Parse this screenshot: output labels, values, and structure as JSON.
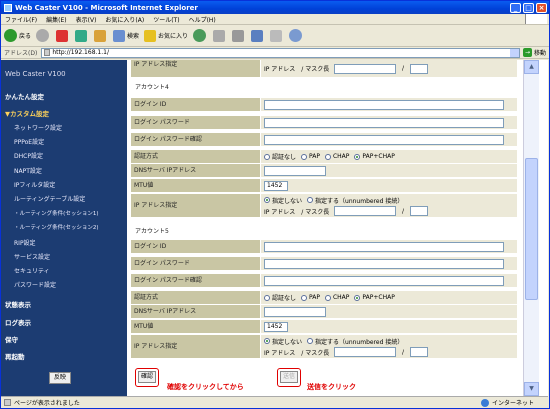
{
  "window": {
    "title": "Web Caster V100 - Microsoft Internet Explorer"
  },
  "menu": [
    "ファイル(F)",
    "編集(E)",
    "表示(V)",
    "お気に入り(A)",
    "ツール(T)",
    "ヘルプ(H)"
  ],
  "toolbar": {
    "back": "戻る",
    "search": "検索",
    "favorites": "お気に入り"
  },
  "address": {
    "label": "アドレス(D)",
    "url": "http://192.168.1.1/",
    "go": "移動"
  },
  "sidebar": {
    "brand": "Web Caster V100",
    "easy": "かんたん設定",
    "custom": "▼カスタム設定",
    "items": [
      "ネットワーク設定",
      "PPPoE設定",
      "DHCP設定",
      "NAPT設定",
      "IPフィルタ設定",
      "ルーティングテーブル設定",
      "・ルーティング条件(セッション1)",
      "・ルーティング条件(セッション2)",
      "RIP設定",
      "サービス設定",
      "セキュリティ",
      "パスワード設定"
    ],
    "status": "状態表示",
    "log": "ログ表示",
    "save": "保守",
    "reboot": "再起動",
    "reflect": "反映"
  },
  "form": {
    "top_ip_label": "IP アドレス指定",
    "ip_mask": "IP アドレス　/ マスク長",
    "slash": "/",
    "account4": "アカウント4",
    "account5": "アカウント5",
    "login_id": "ログイン ID",
    "login_pw": "ログイン パスワード",
    "login_pw_confirm": "ログイン パスワード確認",
    "auth": "認証方式",
    "auth_opts": [
      "認証なし",
      "PAP",
      "CHAP",
      "PAP+CHAP"
    ],
    "dns": "DNSサーバ IPアドレス",
    "mtu": "MTU値",
    "mtu_value": "1452",
    "ip_assign": "IP アドレス指定",
    "ip_no": "指定しない",
    "ip_yes": "指定する（unnumbered 接続）"
  },
  "buttons": {
    "confirm": "確認",
    "send": "送信"
  },
  "notes": {
    "confirm_note": "確認をクリックしてから",
    "send_note": "送信をクリック"
  },
  "status": {
    "left": "ページが表示されました",
    "zone": "インターネット"
  }
}
